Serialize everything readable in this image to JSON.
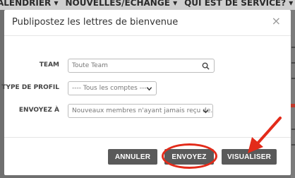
{
  "background": {
    "nav_items": [
      "ALENDRIER ▾",
      "NOUVELLES/ECHANGE ▾",
      "QUI EST DE SERVICE? ▾"
    ]
  },
  "modal": {
    "title": "Publipostez les lettres de bienvenue",
    "close_symbol": "×",
    "fields": {
      "team": {
        "label": "TEAM",
        "placeholder": "Toute Team"
      },
      "profile_type": {
        "label": "TYPE DE PROFIL",
        "value": "---- Tous les comptes ----"
      },
      "send_to": {
        "label": "ENVOYEZ À",
        "value": "Nouveaux membres n'ayant jamais reçu de..."
      }
    },
    "buttons": {
      "cancel": "ANNULER",
      "send": "ENVOYEZ",
      "preview": "VISUALISER"
    }
  },
  "colors": {
    "button_bg": "#5a5a5a",
    "annotation": "#e32b1a",
    "overlay": "#6f6f6f"
  }
}
